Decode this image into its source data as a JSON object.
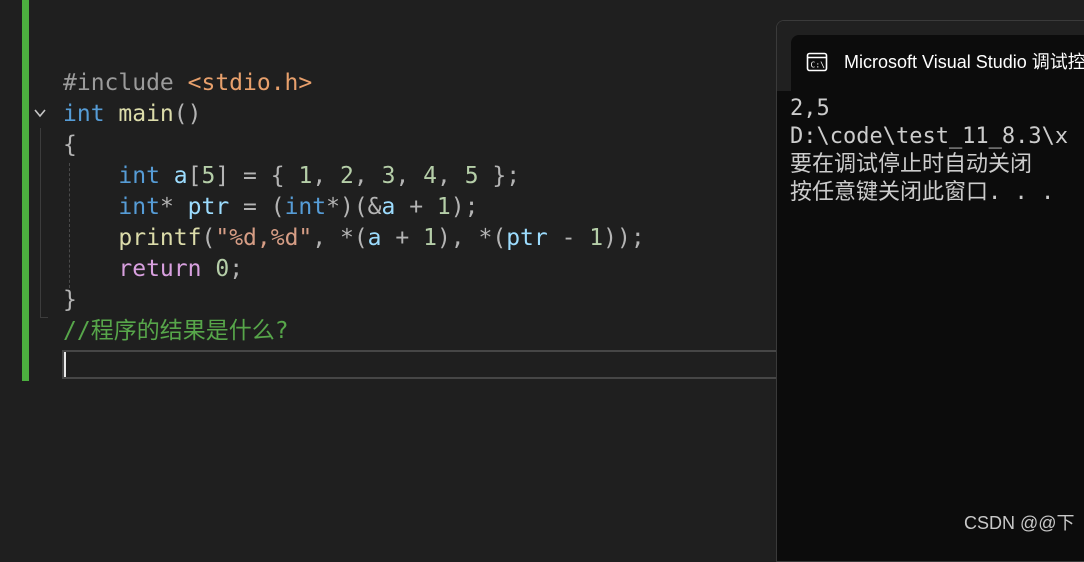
{
  "editor": {
    "lines": [
      {
        "parts": [
          [
            "pp",
            "#include "
          ],
          [
            "inc",
            "<stdio.h>"
          ]
        ]
      },
      {
        "parts": [
          [
            "kw",
            "int"
          ],
          [
            "fn",
            " main"
          ],
          [
            "punc",
            "()"
          ]
        ]
      },
      {
        "parts": [
          [
            "punc",
            "{"
          ]
        ]
      },
      {
        "parts": [
          [
            "kw",
            "    int"
          ],
          [
            "var",
            " a"
          ],
          [
            "punc",
            "["
          ],
          [
            "num",
            "5"
          ],
          [
            "punc",
            "] = { "
          ],
          [
            "num",
            "1"
          ],
          [
            "punc",
            ", "
          ],
          [
            "num",
            "2"
          ],
          [
            "punc",
            ", "
          ],
          [
            "num",
            "3"
          ],
          [
            "punc",
            ", "
          ],
          [
            "num",
            "4"
          ],
          [
            "punc",
            ", "
          ],
          [
            "num",
            "5"
          ],
          [
            "punc",
            " };"
          ]
        ]
      },
      {
        "parts": [
          [
            "kw",
            "    int"
          ],
          [
            "punc",
            "* "
          ],
          [
            "var",
            "ptr"
          ],
          [
            "punc",
            " = ("
          ],
          [
            "kw",
            "int"
          ],
          [
            "punc",
            "*)(&"
          ],
          [
            "var",
            "a"
          ],
          [
            "punc",
            " + "
          ],
          [
            "num",
            "1"
          ],
          [
            "punc",
            ");"
          ]
        ]
      },
      {
        "parts": [
          [
            "fn",
            "    printf"
          ],
          [
            "punc",
            "("
          ],
          [
            "str",
            "\"%d,%d\""
          ],
          [
            "punc",
            ", *("
          ],
          [
            "var",
            "a"
          ],
          [
            "punc",
            " + "
          ],
          [
            "num",
            "1"
          ],
          [
            "punc",
            "), *("
          ],
          [
            "var",
            "ptr"
          ],
          [
            "punc",
            " - "
          ],
          [
            "num",
            "1"
          ],
          [
            "punc",
            "));"
          ]
        ]
      },
      {
        "parts": [
          [
            "ctl",
            "    return"
          ],
          [
            "punc",
            " "
          ],
          [
            "num",
            "0"
          ],
          [
            "punc",
            ";"
          ]
        ]
      },
      {
        "parts": [
          [
            "punc",
            "}"
          ]
        ]
      },
      {
        "parts": [
          [
            "cmt",
            "//程序的结果是什么?"
          ]
        ]
      }
    ]
  },
  "console": {
    "title": "Microsoft Visual Studio 调试控",
    "output": [
      "2,5",
      "D:\\code\\test_11_8.3\\x",
      "要在调试停止时自动关闭",
      "按任意键关闭此窗口. . ."
    ]
  },
  "watermark": "CSDN @@下",
  "colors": {
    "background": "#1f1f1f",
    "changeBar": "#4caf3f",
    "keyword": "#569cd6",
    "function": "#dcdcaa",
    "variable": "#9cdcfe",
    "number": "#b5cea8",
    "string": "#d69d85",
    "control": "#d8a0df",
    "comment": "#57a64a"
  },
  "icons": {
    "fold": "chevron-down-icon",
    "terminal": "terminal-icon"
  }
}
